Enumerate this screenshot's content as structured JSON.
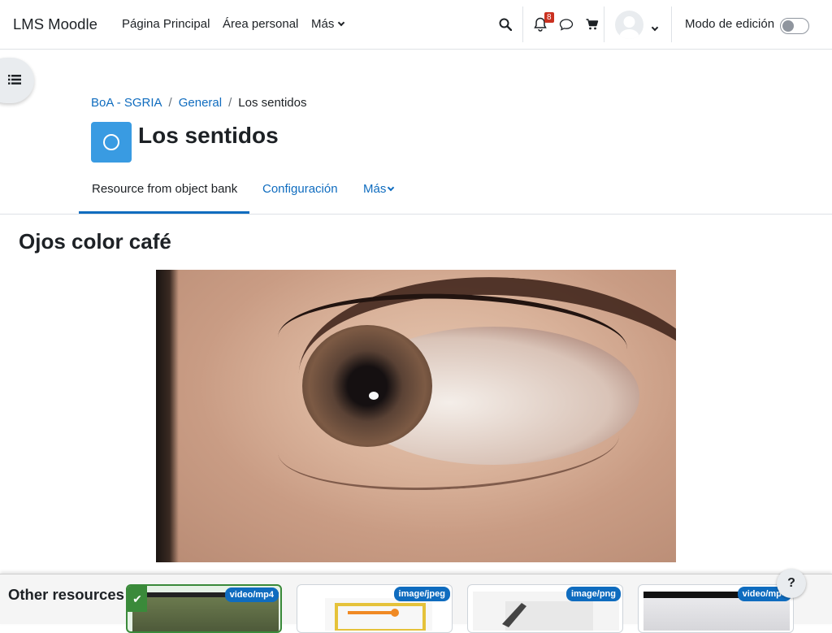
{
  "navbar": {
    "brand": "LMS Moodle",
    "links": [
      "Página Principal",
      "Área personal"
    ],
    "more_label": "Más",
    "notification_count": "8",
    "edit_mode_label": "Modo de edición",
    "edit_mode_on": false,
    "icons": [
      "search-icon",
      "bell-icon",
      "chat-icon",
      "cart-icon",
      "avatar"
    ]
  },
  "breadcrumb": {
    "items": [
      "BoA - SGRIA",
      "General"
    ],
    "current": "Los sentidos"
  },
  "page": {
    "title": "Los sentidos",
    "activity_color": "#399be2"
  },
  "secondary_nav": {
    "tabs": [
      "Resource from object bank",
      "Configuración"
    ],
    "more_label": "Más",
    "active_index": 0
  },
  "content": {
    "title": "Ojos color café"
  },
  "resources": {
    "title": "Other resources",
    "cards": [
      {
        "mime": "video/mp4",
        "selected": true,
        "check": "✔"
      },
      {
        "mime": "image/jpeg",
        "selected": false
      },
      {
        "mime": "image/png",
        "selected": false
      },
      {
        "mime": "video/mp4",
        "selected": false
      }
    ]
  },
  "help_label": "?"
}
